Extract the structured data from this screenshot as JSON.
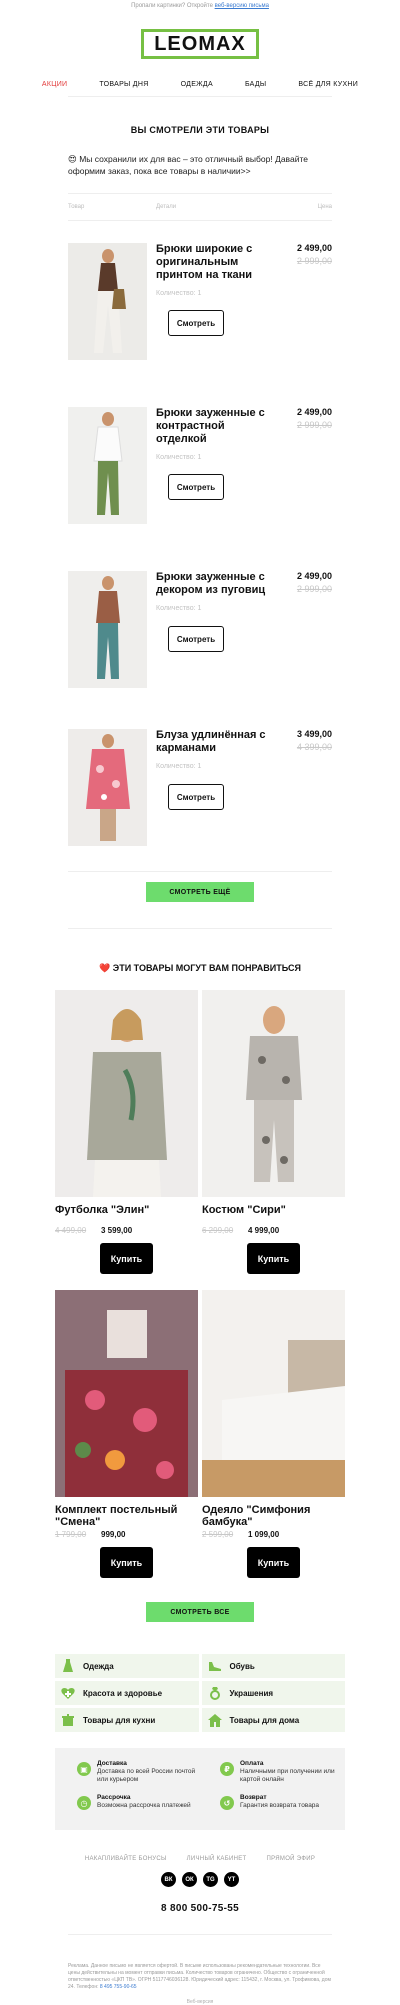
{
  "preheader": {
    "text": "Пропали картинки? Откройте",
    "link": "веб-версию письма"
  },
  "logo": "LEOMAX",
  "nav": [
    "АКЦИИ",
    "ТОВАРЫ ДНЯ",
    "ОДЕЖДА",
    "БАДЫ",
    "ВСЁ ДЛЯ КУХНИ"
  ],
  "viewed": {
    "title": "ВЫ СМОТРЕЛИ ЭТИ ТОВАРЫ",
    "intro": "😍 Мы сохранили их для вас – это отличный выбор! Давайте оформим заказ, пока все товары в наличии>>",
    "col_item": "Товар",
    "col_detail": "Детали",
    "col_price": "Цена",
    "products": [
      {
        "name": "Брюки широкие с оригинальным принтом на ткани",
        "qty": "Количество: 1",
        "price": "2 499,00",
        "old": "2 999,00",
        "button": "Смотреть"
      },
      {
        "name": "Брюки зауженные с контрастной отделкой",
        "qty": "Количество: 1",
        "price": "2 499,00",
        "old": "2 999,00",
        "button": "Смотреть"
      },
      {
        "name": "Брюки зауженные с декором из пуговиц",
        "qty": "Количество: 1",
        "price": "2 499,00",
        "old": "2 999,00",
        "button": "Смотреть"
      },
      {
        "name": "Блуза удлинённая с карманами",
        "qty": "Количество: 1",
        "price": "3 499,00",
        "old": "4 399,00",
        "button": "Смотреть"
      }
    ],
    "more_button": "СМОТРЕТЬ ЕЩЁ"
  },
  "recommend": {
    "title": "ЭТИ ТОВАРЫ МОГУТ ВАМ ПОНРАВИТЬСЯ",
    "heart": "❤️",
    "items": [
      {
        "title": "Футболка \"Элин\"",
        "old": "4 499,00",
        "price": "3 599,00",
        "button": "Купить",
        "color": "#a8a89a"
      },
      {
        "title": "Костюм \"Сири\"",
        "old": "6 299,00",
        "price": "4 999,00",
        "button": "Купить",
        "color": "#b8b4ae"
      },
      {
        "title": "Комплект постельный \"Смена\"",
        "old": "1 799,00",
        "price": "999,00",
        "button": "Купить",
        "color": "#8f2f3a"
      },
      {
        "title": "Одеяло \"Симфония бамбука\"",
        "old": "2 599,00",
        "price": "1 099,00",
        "button": "Купить",
        "color": "#e8e6e2"
      }
    ],
    "all_button": "СМОТРЕТЬ ВСЕ"
  },
  "categories": [
    {
      "label": "Одежда",
      "icon": "dress-icon"
    },
    {
      "label": "Обувь",
      "icon": "shoe-icon"
    },
    {
      "label": "Красота и здоровье",
      "icon": "heart-plus-icon"
    },
    {
      "label": "Украшения",
      "icon": "ring-icon"
    },
    {
      "label": "Товары для кухни",
      "icon": "pot-icon"
    },
    {
      "label": "Товары для дома",
      "icon": "house-icon"
    }
  ],
  "info": {
    "delivery": {
      "title": "Доставка",
      "text": "Доставка по всей России почтой или курьером"
    },
    "payment": {
      "title": "Оплата",
      "text": "Наличными при получении или картой онлайн"
    },
    "installment": {
      "title": "Рассрочка",
      "text": "Возможна рассрочка платежей"
    },
    "returns": {
      "title": "Возврат",
      "text": "Гарантия возврата товара"
    }
  },
  "footer_links": [
    "НАКАПЛИВАЙТЕ БОНУСЫ",
    "ЛИЧНЫЙ КАБИНЕТ",
    "ПРЯМОЙ ЭФИР"
  ],
  "social": [
    "ВК",
    "ОК",
    "TG",
    "YT"
  ],
  "phone": "8 800 500-75-55",
  "legal": "Реклама. Данное письмо не является офертой. В письме использованы рекомендательные технологии. Все цены действительны на момент отправки письма. Количество товаров ограничено. Общество с ограниченной ответственностью «ЦКП ТВ». ОГРН 5117746036128. Юридический адрес: 115432, г. Москва, ул. Трофимова, дом 24. Телефон:",
  "legal_phone": "8 495 755-90-65",
  "web_version": "Веб-версия",
  "colors": {
    "accent_green": "#6ddc6d",
    "logo_green": "#76c043",
    "sale_red": "#e23a3a"
  }
}
